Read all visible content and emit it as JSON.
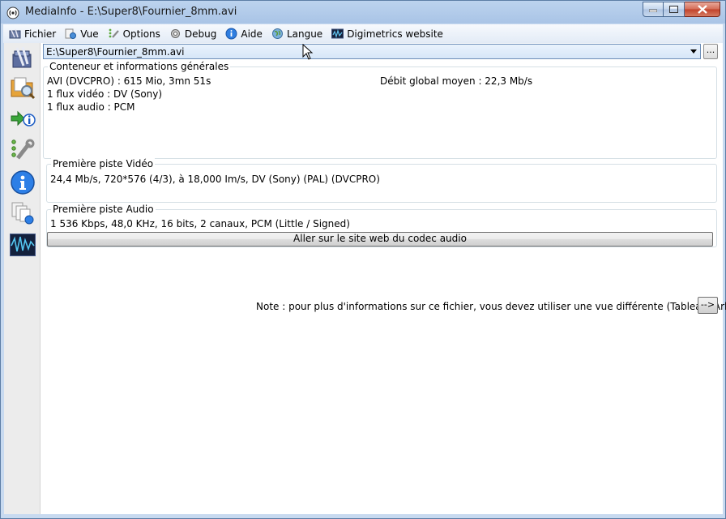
{
  "window": {
    "title": "MediaInfo - E:\\Super8\\Fournier_8mm.avi",
    "icon": "mediainfo-app-icon"
  },
  "menu": [
    {
      "label": "Fichier",
      "icon": "folder-icon"
    },
    {
      "label": "Vue",
      "icon": "view-icon"
    },
    {
      "label": "Options",
      "icon": "options-icon"
    },
    {
      "label": "Debug",
      "icon": "debug-icon"
    },
    {
      "label": "Aide",
      "icon": "help-icon"
    },
    {
      "label": "Langue",
      "icon": "globe-icon"
    },
    {
      "label": "Digimetrics website",
      "icon": "digimetrics-icon"
    }
  ],
  "file": {
    "path": "E:\\Super8\\Fournier_8mm.avi",
    "browse_label": "..."
  },
  "general": {
    "title": "Conteneur et informations générales",
    "line1": "AVI (DVCPRO) : 615 Mio, 3mn 51s",
    "line2": "1 flux vidéo : DV (Sony)",
    "line3": "1 flux audio : PCM",
    "bitrate": "Débit global moyen : 22,3 Mb/s"
  },
  "video": {
    "title": "Première piste Vidéo",
    "line1": "24,4 Mb/s, 720*576 (4/3), à 18,000 Im/s, DV (Sony) (PAL) (DVCPRO)"
  },
  "audio": {
    "title": "Première piste Audio",
    "line1": "1 536 Kbps, 48,0 KHz, 16 bits, 2 canaux, PCM (Little / Signed)",
    "button": "Aller sur le site web du codec audio"
  },
  "note": {
    "text": "Note : pour plus d'informations sur ce fichier, vous devez utiliser une vue différente (Tableau, Arbre...)",
    "button": "-->"
  },
  "colors": {
    "accent": "#1a62c9",
    "close": "#c2412a"
  }
}
